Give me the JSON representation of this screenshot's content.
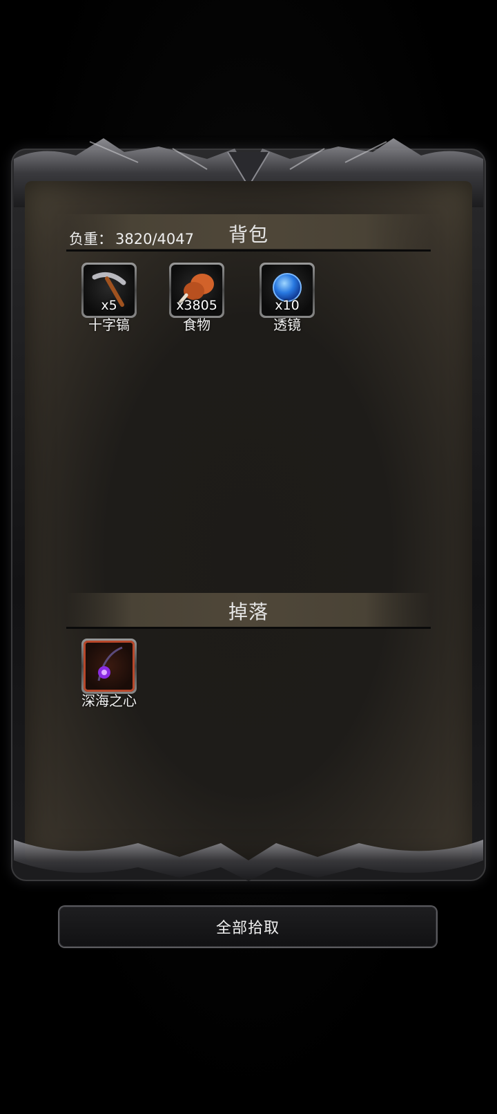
{
  "backpack": {
    "title": "背包",
    "weight_label": "负重：",
    "weight_value": "3820/4047",
    "items": [
      {
        "name": "十字镐",
        "count": "x5",
        "icon": "pickaxe-icon"
      },
      {
        "name": "食物",
        "count": "x3805",
        "icon": "meat-drumstick-icon"
      },
      {
        "name": "透镜",
        "count": "x10",
        "icon": "blue-orb-lens-icon"
      }
    ]
  },
  "drops": {
    "title": "掉落",
    "items": [
      {
        "name": "深海之心",
        "icon": "purple-amulet-icon"
      }
    ]
  },
  "pickup_all_label": "全部拾取",
  "colors": {
    "background": "#000000",
    "panel": "#1e1c19",
    "band": "#4f4739",
    "text": "#efefef",
    "drop_border": "#b8472a"
  }
}
